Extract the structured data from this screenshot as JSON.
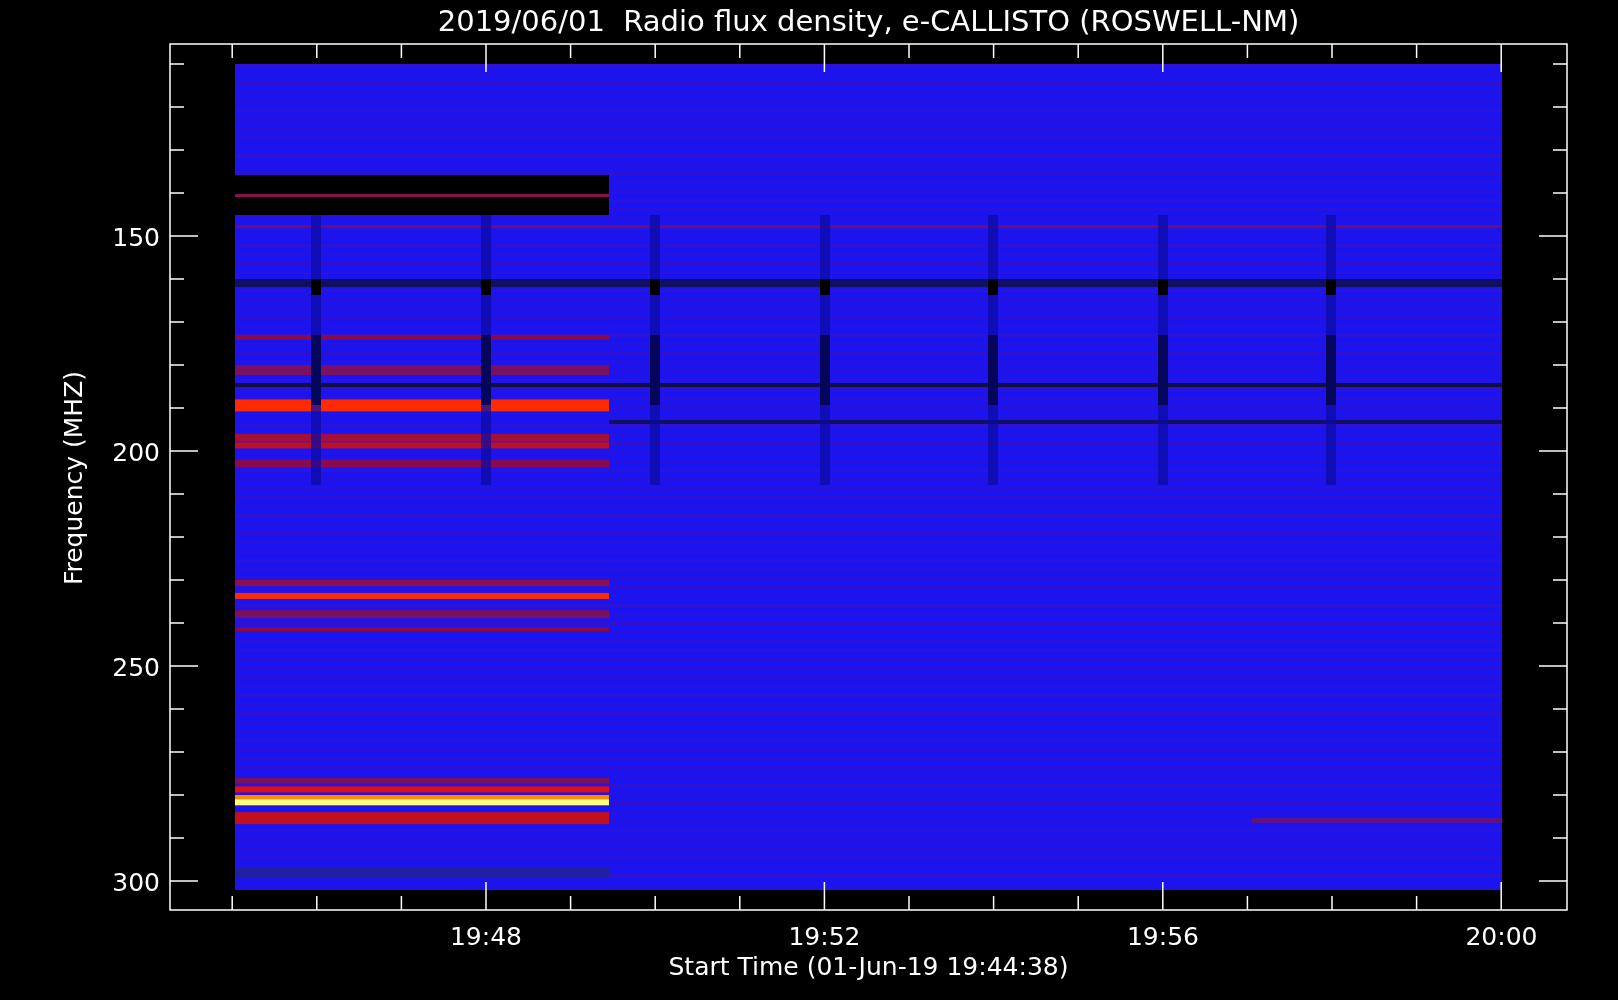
{
  "title": "2019/06/01  Radio flux density, e-CALLISTO (ROSWELL-NM)",
  "ylabel": "Frequency (MHZ)",
  "xlabel": "Start Time (01-Jun-19 19:44:38)",
  "yticks": [
    "150",
    "200",
    "250",
    "300"
  ],
  "xticks": [
    "19:48",
    "19:52",
    "19:56",
    "20:00"
  ]
}
